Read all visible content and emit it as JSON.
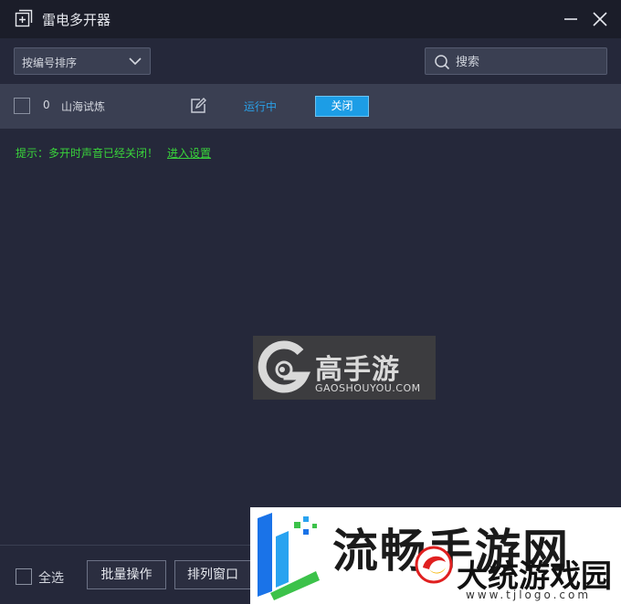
{
  "window": {
    "title": "雷电多开器",
    "icons": [
      "add-window-icon",
      "minimize-icon",
      "close-icon"
    ]
  },
  "toolbar": {
    "sort_label": "按编号排序",
    "search_placeholder": "搜索"
  },
  "instances": [
    {
      "index": "0",
      "name": "山海试炼",
      "status": "运行中",
      "action_label": "关闭"
    }
  ],
  "tip": {
    "text": "提示：多开时声音已经关闭！",
    "link": "进入设置"
  },
  "bottom": {
    "select_all": "全选",
    "batch_label": "批量操作",
    "arrange_label": "排列窗口"
  },
  "watermarks": {
    "center_cn": "高手游",
    "center_en": "GAOSHOUYOU.COM",
    "corner_big": "流畅手游网",
    "corner_brand": "大统游戏园",
    "corner_url": "www.tjlogo.com"
  },
  "colors": {
    "accent": "#1c9de6",
    "status": "#2aa0e8",
    "tip": "#39d43b",
    "background": "#25283a"
  }
}
